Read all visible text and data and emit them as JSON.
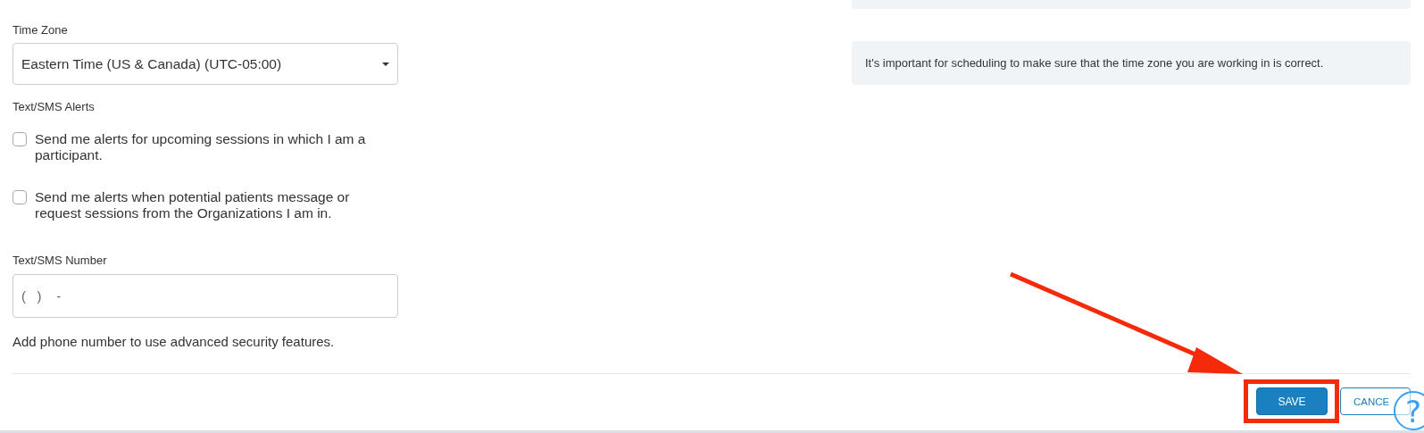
{
  "timezone": {
    "label": "Time Zone",
    "value": "Eastern Time (US & Canada) (UTC-05:00)"
  },
  "timezone_note": "It's important for scheduling to make sure that the time zone you are working in is correct.",
  "alerts": {
    "label": "Text/SMS Alerts",
    "options": [
      {
        "text": "Send me alerts for upcoming sessions in which I am a participant.",
        "checked": false
      },
      {
        "text": "Send me alerts when potential patients message or request sessions from the Organizations I am in.",
        "checked": false
      }
    ]
  },
  "sms_number": {
    "label": "Text/SMS Number",
    "placeholder": "(   )    -",
    "hint": "Add phone number to use advanced security features."
  },
  "buttons": [
    {
      "label": "SAVE",
      "kind": "primary",
      "highlighted": true
    },
    {
      "label": "CANCE",
      "kind": "secondary",
      "highlighted": false
    }
  ],
  "help": {
    "label": "?"
  }
}
